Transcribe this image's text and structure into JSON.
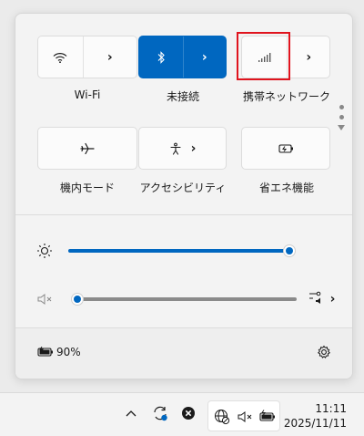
{
  "quick_settings": {
    "tiles": [
      {
        "id": "wifi",
        "label": "Wi-Fi",
        "icon": "wifi-icon",
        "active": false,
        "has_arrow": true
      },
      {
        "id": "bluetooth",
        "label": "未接続",
        "icon": "bluetooth-icon",
        "active": true,
        "has_arrow": true
      },
      {
        "id": "cellular",
        "label": "携帯ネットワーク",
        "icon": "cellular-signal-icon",
        "active": false,
        "has_arrow": true,
        "highlighted": true
      },
      {
        "id": "airplane",
        "label": "機内モード",
        "icon": "airplane-icon",
        "active": false,
        "has_arrow": false
      },
      {
        "id": "accessibility",
        "label": "アクセシビリティ",
        "icon": "accessibility-icon",
        "active": false,
        "has_arrow": true
      },
      {
        "id": "battery_saver",
        "label": "省エネ機能",
        "icon": "battery-saver-icon",
        "active": false,
        "has_arrow": false
      }
    ],
    "brightness": {
      "icon": "brightness-icon",
      "value": 100
    },
    "volume": {
      "icon": "muted-speaker-icon",
      "value": 0,
      "output_icon": "audio-output-icon"
    },
    "footer": {
      "battery_percent": "90%",
      "battery_icon": "battery-charging-icon",
      "settings_icon": "gear-icon"
    }
  },
  "taskbar": {
    "clock": {
      "time": "11:11",
      "date": "2025/11/11"
    },
    "icons": [
      "chevron-up-icon",
      "sync-icon",
      "close-circle-icon",
      "network-icon",
      "muted-speaker-icon",
      "battery-charging-icon"
    ]
  },
  "colors": {
    "accent": "#0067c0",
    "highlight": "#e0141e"
  }
}
